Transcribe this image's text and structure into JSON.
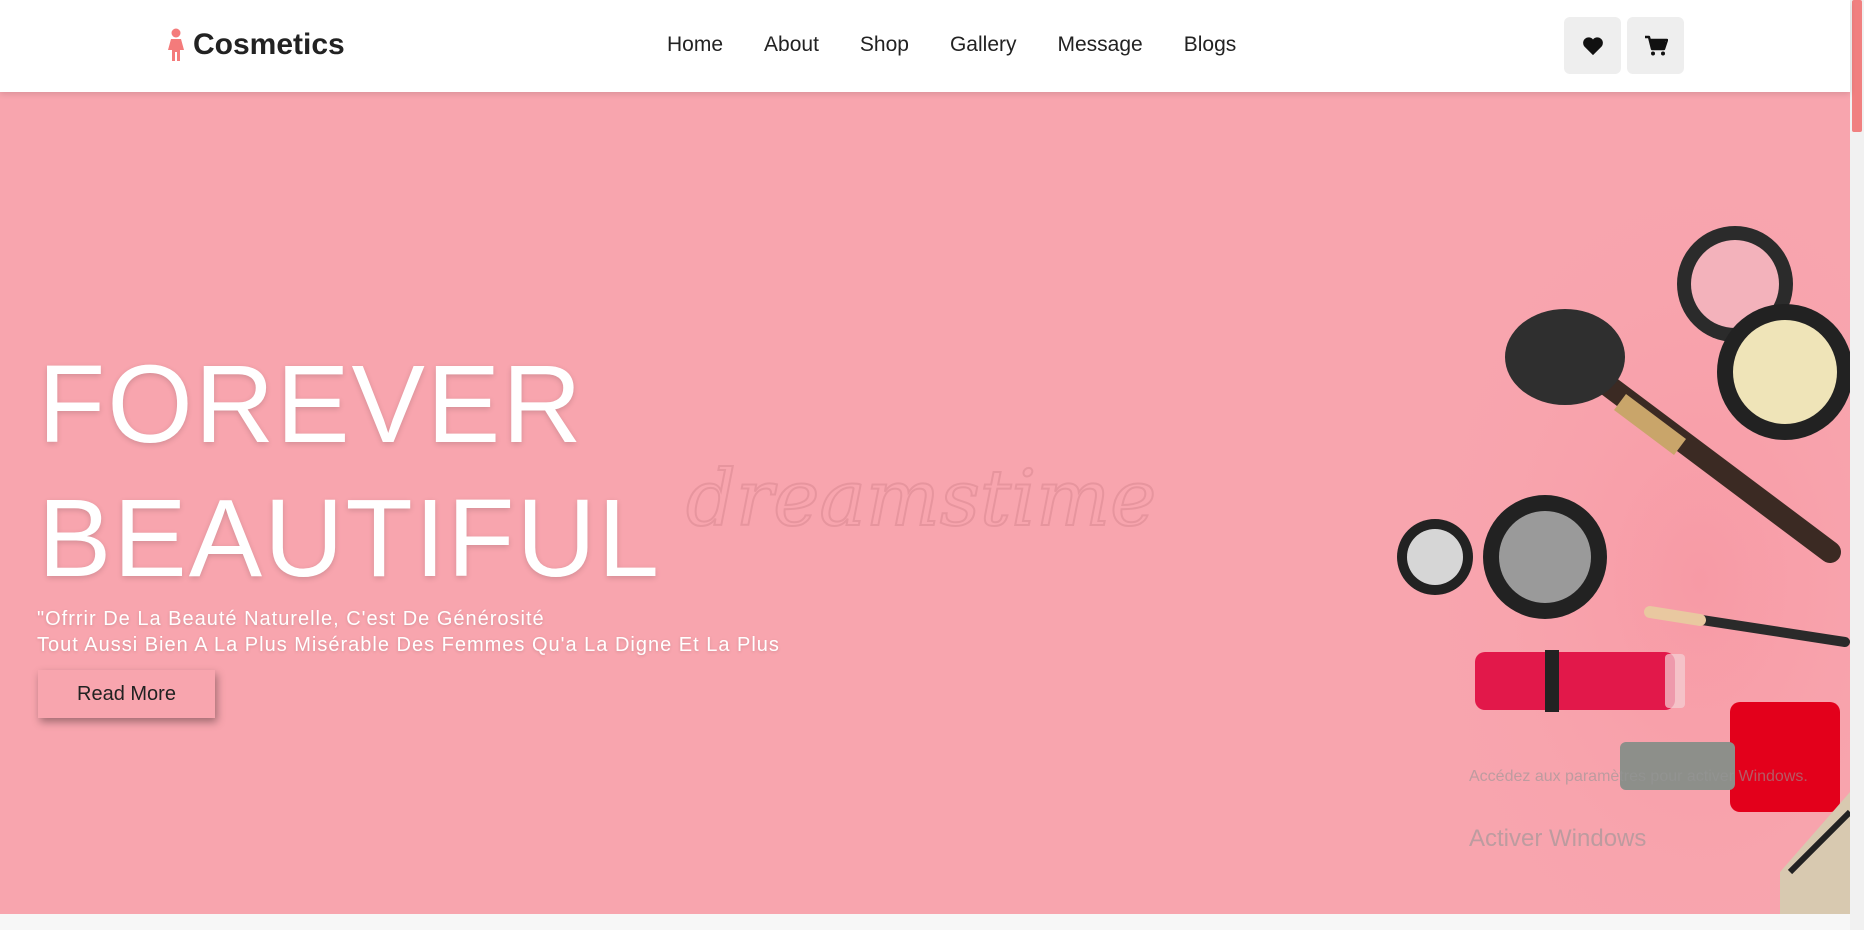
{
  "brand": {
    "name": "Cosmetics",
    "color": "#f47b7b"
  },
  "nav": {
    "items": [
      "Home",
      "About",
      "Shop",
      "Gallery",
      "Message",
      "Blogs"
    ]
  },
  "actions": {
    "wishlist_icon": "heart-icon",
    "cart_icon": "cart-icon"
  },
  "hero": {
    "title_line1": "FOREVER",
    "title_line2": "BEAUTIFUL",
    "subtitle_line1": "\"Ofrrir De La Beauté Naturelle, C'est De Générosité",
    "subtitle_line2": "Tout Aussi Bien A La Plus Misérable Des Femmes Qu'a La Digne Et La Plus",
    "button_label": "Read More",
    "background": "#f8a5ae"
  },
  "watermark": "dreamstime",
  "os_overlay": {
    "title": "Activer Windows",
    "subtitle": "Accédez aux paramètres pour activer Windows."
  }
}
